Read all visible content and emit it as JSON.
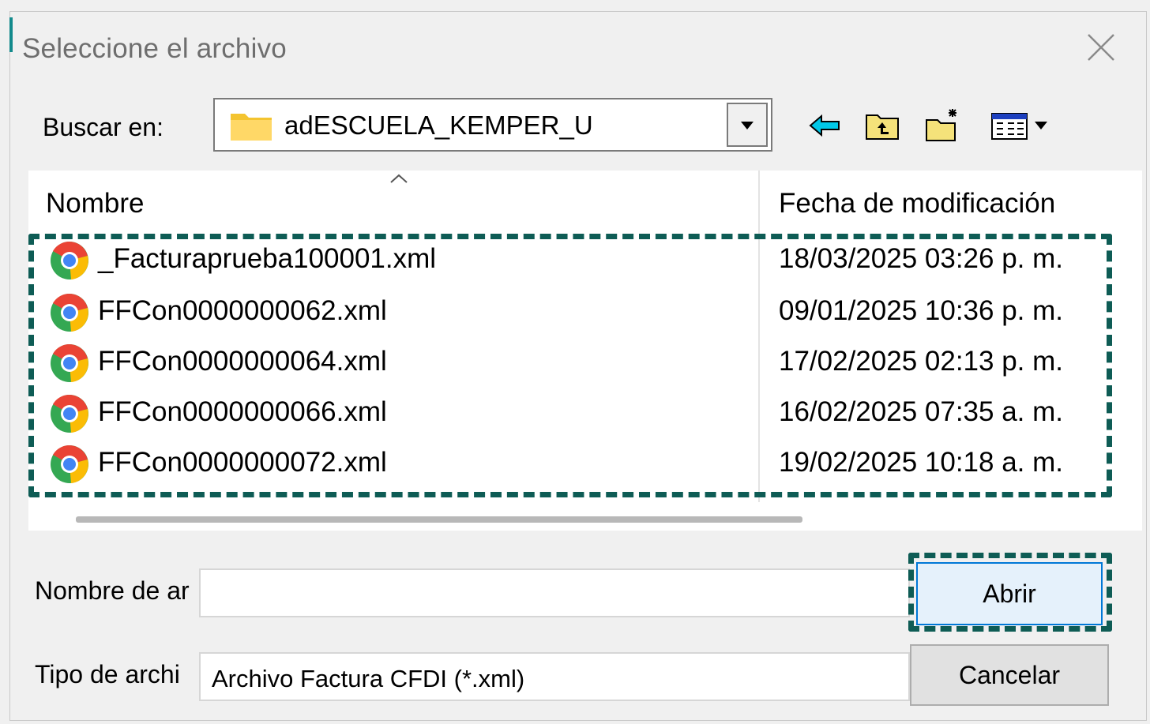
{
  "dialog": {
    "title": "Seleccione el archivo",
    "close_icon": "close-icon"
  },
  "lookin": {
    "label": "Buscar en:",
    "value": "adESCUELA_KEMPER_U",
    "icon": "folder-icon"
  },
  "toolbar": {
    "icons": [
      "back-arrow-icon",
      "up-folder-icon",
      "new-folder-icon",
      "view-menu-icon"
    ],
    "colors": {
      "back_arrow": "#00c8e8",
      "folder": "#f5e27a"
    }
  },
  "listview": {
    "columns": [
      "Nombre",
      "Fecha de modificación"
    ],
    "files": [
      {
        "name": "_Facturaprueba100001.xml",
        "date": "18/03/2025 03:26 p. m.",
        "icon": "chrome-icon"
      },
      {
        "name": "FFCon0000000062.xml",
        "date": "09/01/2025 10:36 p. m.",
        "icon": "chrome-icon"
      },
      {
        "name": "FFCon0000000064.xml",
        "date": "17/02/2025 02:13 p. m.",
        "icon": "chrome-icon"
      },
      {
        "name": "FFCon0000000066.xml",
        "date": "16/02/2025 07:35 a. m.",
        "icon": "chrome-icon"
      },
      {
        "name": "FFCon0000000072.xml",
        "date": "19/02/2025 10:18 a. m.",
        "icon": "chrome-icon"
      }
    ]
  },
  "filename": {
    "label": "Nombre de ar",
    "value": ""
  },
  "filetype": {
    "label": "Tipo de archi",
    "value": "Archivo Factura CFDI (*.xml)"
  },
  "buttons": {
    "open": "Abrir",
    "cancel": "Cancelar"
  },
  "highlight_color": "#0e5c55"
}
